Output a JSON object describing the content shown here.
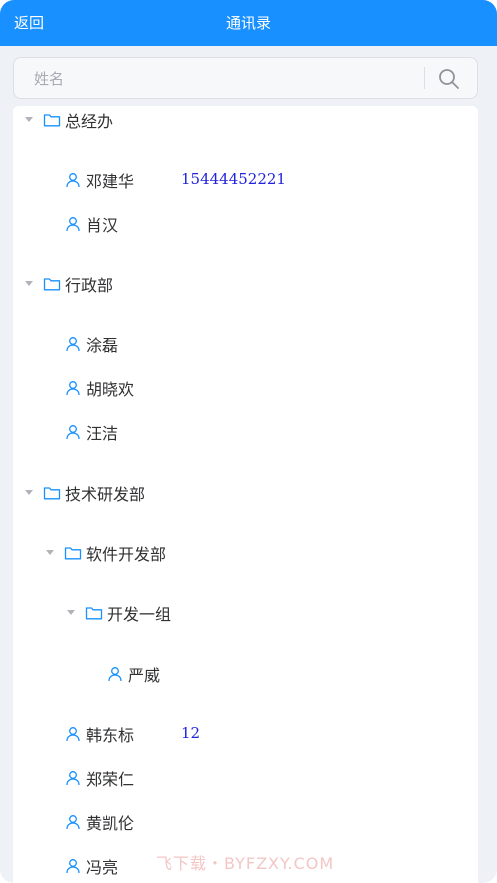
{
  "header": {
    "back_label": "返回",
    "title": "通讯录"
  },
  "search": {
    "placeholder": "姓名"
  },
  "tree": {
    "dept_1": "总经办",
    "dept_1_member_1": "邓建华",
    "dept_1_member_1_phone": "15444452221",
    "dept_1_member_2": "肖汉",
    "dept_2": "行政部",
    "dept_2_member_1": "涂磊",
    "dept_2_member_2": "胡晓欢",
    "dept_2_member_3": "汪洁",
    "dept_3": "技术研发部",
    "dept_3_sub_1": "软件开发部",
    "dept_3_sub_1_sub_1": "开发一组",
    "dept_3_sub_1_sub_1_member_1": "严威",
    "dept_3_member_1": "韩东标",
    "dept_3_member_1_phone": "12",
    "dept_3_member_2": "郑荣仁",
    "dept_3_member_3": "黄凯伦",
    "dept_3_member_4": "冯亮"
  },
  "watermark": "飞下载・BYFZXY.COM",
  "colors": {
    "header": "#1890ff",
    "icon": "#1890ff",
    "phone": "#2222dd"
  }
}
